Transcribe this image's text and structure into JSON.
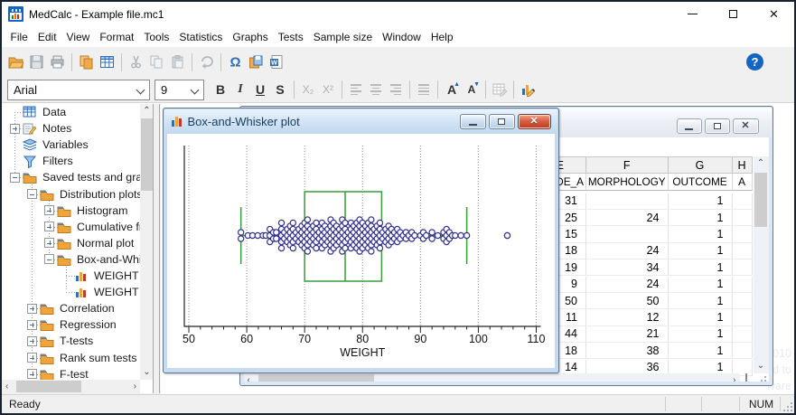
{
  "window": {
    "title": "MedCalc - Example file.mc1",
    "controls": [
      "minimize",
      "maximize",
      "close"
    ]
  },
  "menu": {
    "items": [
      "File",
      "Edit",
      "View",
      "Format",
      "Tools",
      "Statistics",
      "Graphs",
      "Tests",
      "Sample size",
      "Window",
      "Help"
    ]
  },
  "toolbar": {
    "groups": [
      [
        "open-file-icon",
        "save-icon",
        "print-icon"
      ],
      [
        "copy-object-icon",
        "table-icon"
      ],
      [
        "cut-icon",
        "copy-icon",
        "paste-icon"
      ],
      [
        "undo-icon"
      ],
      [
        "omega-icon",
        "save-all-icon",
        "export-word-icon"
      ]
    ],
    "help_label": "?"
  },
  "format_bar": {
    "font_name": "Arial",
    "font_size": "9",
    "bold": "B",
    "italic": "I",
    "underline": "U",
    "strike": "S",
    "subscript": "X₂",
    "superscript": "X²",
    "grow_font": "A",
    "shrink_font": "A"
  },
  "tree": {
    "items": [
      {
        "label": "Data",
        "level": 0,
        "expander": "",
        "icon": "table"
      },
      {
        "label": "Notes",
        "level": 0,
        "expander": "+",
        "icon": "notes"
      },
      {
        "label": "Variables",
        "level": 0,
        "expander": "",
        "icon": "layers"
      },
      {
        "label": "Filters",
        "level": 0,
        "expander": "",
        "icon": "funnel"
      },
      {
        "label": "Saved tests and graphs",
        "level": 0,
        "expander": "-",
        "icon": "folder"
      },
      {
        "label": "Distribution plots",
        "level": 1,
        "expander": "-",
        "icon": "folder"
      },
      {
        "label": "Histogram",
        "level": 2,
        "expander": "+",
        "icon": "folder"
      },
      {
        "label": "Cumulative freq.",
        "level": 2,
        "expander": "+",
        "icon": "folder"
      },
      {
        "label": "Normal plot",
        "level": 2,
        "expander": "+",
        "icon": "folder"
      },
      {
        "label": "Box-and-Whisker",
        "level": 2,
        "expander": "-",
        "icon": "folder"
      },
      {
        "label": "WEIGHT",
        "level": 3,
        "expander": "",
        "icon": "chart"
      },
      {
        "label": "WEIGHT",
        "level": 3,
        "expander": "",
        "icon": "chart"
      },
      {
        "label": "Correlation",
        "level": 1,
        "expander": "+",
        "icon": "folder"
      },
      {
        "label": "Regression",
        "level": 1,
        "expander": "+",
        "icon": "folder"
      },
      {
        "label": "T-tests",
        "level": 1,
        "expander": "+",
        "icon": "folder"
      },
      {
        "label": "Rank sum tests",
        "level": 1,
        "expander": "+",
        "icon": "folder"
      },
      {
        "label": "F-test",
        "level": 1,
        "expander": "+",
        "icon": "folder"
      }
    ]
  },
  "plot_window": {
    "title": "Box-and-Whisker plot",
    "controls": [
      "minimize",
      "restore",
      "close"
    ]
  },
  "chart_data": {
    "type": "box-and-whisker-with-dots",
    "xlabel": "WEIGHT",
    "x_ticks": [
      50,
      60,
      70,
      80,
      90,
      100,
      110
    ],
    "x_minor_step": 2,
    "xlim": [
      50,
      110
    ],
    "grid": "dotted-vertical",
    "box": {
      "lower_whisker": 59,
      "q1": 70,
      "median": 77,
      "q3": 83.3,
      "upper_whisker": 98
    },
    "outliers": [
      105
    ],
    "box_color": "#3a9b3a",
    "dot_color": "#32328f",
    "points_freq": [
      [
        59,
        2
      ],
      [
        60.2,
        1
      ],
      [
        61,
        1
      ],
      [
        61.9,
        1
      ],
      [
        62.8,
        1
      ],
      [
        63.3,
        1
      ],
      [
        64,
        3
      ],
      [
        64.6,
        2
      ],
      [
        65.1,
        2
      ],
      [
        66,
        5
      ],
      [
        66.5,
        2
      ],
      [
        67,
        3
      ],
      [
        67.5,
        4
      ],
      [
        68,
        5
      ],
      [
        68.5,
        2
      ],
      [
        69,
        3
      ],
      [
        69.5,
        4
      ],
      [
        70,
        5
      ],
      [
        70.5,
        6
      ],
      [
        71,
        3
      ],
      [
        71.5,
        4
      ],
      [
        72,
        5
      ],
      [
        72.5,
        2
      ],
      [
        73,
        5
      ],
      [
        73.5,
        4
      ],
      [
        74,
        3
      ],
      [
        74.5,
        6
      ],
      [
        75,
        5
      ],
      [
        75.5,
        4
      ],
      [
        76,
        3
      ],
      [
        76.5,
        6
      ],
      [
        77,
        5
      ],
      [
        77.5,
        2
      ],
      [
        78,
        5
      ],
      [
        78.5,
        4
      ],
      [
        79,
        5
      ],
      [
        79.5,
        6
      ],
      [
        80,
        5
      ],
      [
        80.5,
        4
      ],
      [
        81,
        5
      ],
      [
        81.5,
        6
      ],
      [
        82,
        3
      ],
      [
        82.5,
        4
      ],
      [
        83,
        5
      ],
      [
        83.5,
        2
      ],
      [
        84,
        3
      ],
      [
        84.5,
        4
      ],
      [
        85,
        3
      ],
      [
        85.5,
        2
      ],
      [
        86,
        3
      ],
      [
        86.5,
        2
      ],
      [
        87,
        1
      ],
      [
        87.5,
        2
      ],
      [
        88,
        1
      ],
      [
        88.5,
        2
      ],
      [
        89,
        1
      ],
      [
        90,
        1
      ],
      [
        90.5,
        2
      ],
      [
        91,
        1
      ],
      [
        92,
        2
      ],
      [
        93,
        1
      ],
      [
        94,
        2
      ],
      [
        94.5,
        3
      ],
      [
        95,
        2
      ],
      [
        95.5,
        1
      ],
      [
        96,
        1
      ],
      [
        97,
        1
      ],
      [
        98,
        1
      ],
      [
        105,
        1
      ]
    ]
  },
  "spreadsheet": {
    "controls": [
      "minimize",
      "restore",
      "close"
    ],
    "columns": [
      {
        "letter": "E",
        "name": "DE_A",
        "name_align": "right",
        "values": [
          "31",
          "25",
          "15",
          "18",
          "19",
          "9",
          "50",
          "11",
          "44",
          "18",
          "14"
        ]
      },
      {
        "letter": "F",
        "name": "MORPHOLOGY",
        "name_align": "center",
        "values": [
          "",
          "24",
          "",
          "24",
          "34",
          "24",
          "50",
          "12",
          "21",
          "38",
          "36"
        ]
      },
      {
        "letter": "G",
        "name": "OUTCOME",
        "name_align": "center",
        "values": [
          "1",
          "1",
          "1",
          "1",
          "1",
          "1",
          "1",
          "1",
          "1",
          "1",
          "1"
        ]
      },
      {
        "letter": "H",
        "name": "A",
        "name_align": "center",
        "values": [
          "",
          "",
          "",
          "",
          "",
          "",
          "",
          "",
          "",
          "",
          ""
        ]
      }
    ]
  },
  "watermark": {
    "lines": [
      "010",
      "d to",
      "ware"
    ]
  },
  "status_bar": {
    "ready": "Ready",
    "num": "NUM"
  }
}
